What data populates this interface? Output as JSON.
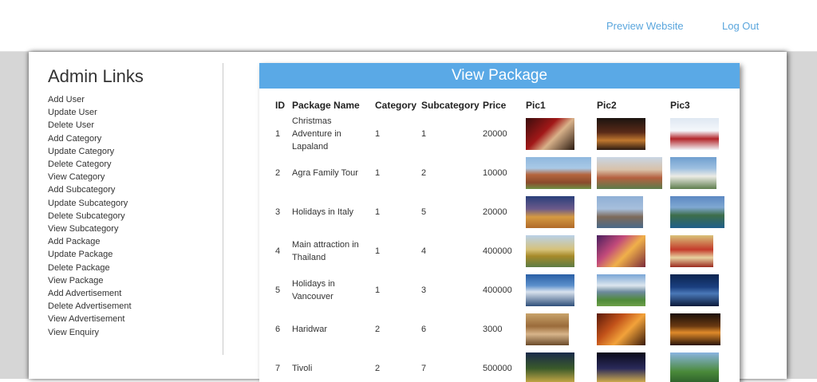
{
  "topnav": {
    "preview_label": "Preview Website",
    "logout_label": "Log Out"
  },
  "sidebar": {
    "title": "Admin Links",
    "links": [
      "Add User",
      "Update User",
      "Delete User",
      "Add Category",
      "Update Category",
      "Delete Category",
      "View Category",
      "Add Subcategory",
      "Update Subcategory",
      "Delete Subcategory",
      "View Subcategory",
      "Add Package",
      "Update Package",
      "Delete Package",
      "View Package",
      "Add Advertisement",
      "Delete Advertisement",
      "View Advertisement",
      "View Enquiry"
    ]
  },
  "panel": {
    "title": "View Package",
    "columns": [
      "ID",
      "Package Name",
      "Category",
      "Subcategory",
      "Price",
      "Pic1",
      "Pic2",
      "Pic3"
    ],
    "rows": [
      {
        "id": "1",
        "name": "Christmas Adventure in Lapaland",
        "category": "1",
        "subcategory": "1",
        "price": "20000",
        "pics": [
          "christmas-santa-photo",
          "christmas-village-photo",
          "christmas-snow-house-photo"
        ]
      },
      {
        "id": "2",
        "name": "Agra Family Tour",
        "category": "1",
        "subcategory": "2",
        "price": "10000",
        "pics": [
          "humayun-tomb-photo",
          "red-fort-photo",
          "taj-mahal-photo"
        ]
      },
      {
        "id": "3",
        "name": "Holidays in Italy",
        "category": "1",
        "subcategory": "5",
        "price": "20000",
        "pics": [
          "colosseum-photo",
          "italian-town-photo",
          "lake-como-photo"
        ]
      },
      {
        "id": "4",
        "name": "Main attraction in Thailand",
        "category": "1",
        "subcategory": "4",
        "price": "400000",
        "pics": [
          "thai-temple-photo",
          "thai-festival-photo",
          "thai-palace-photo"
        ]
      },
      {
        "id": "5",
        "name": "Holidays in Vancouver",
        "category": "1",
        "subcategory": "3",
        "price": "400000",
        "pics": [
          "vancouver-skyline-photo",
          "vancouver-mountains-photo",
          "vancouver-night-photo"
        ]
      },
      {
        "id": "6",
        "name": "Haridwar",
        "category": "2",
        "subcategory": "6",
        "price": "3000",
        "pics": [
          "haridwar-temple-photo",
          "haridwar-festival-photo",
          "haridwar-ghat-night-photo"
        ]
      },
      {
        "id": "7",
        "name": "Tivoli",
        "category": "2",
        "subcategory": "7",
        "price": "500000",
        "pics": [
          "tivoli-gardens-photo",
          "tivoli-night-photo",
          "tivoli-park-photo"
        ]
      }
    ]
  },
  "colors": {
    "accent": "#5aa9e6",
    "link": "#5aa6dd",
    "text": "#333333",
    "page_bg": "#d6d6d6"
  }
}
